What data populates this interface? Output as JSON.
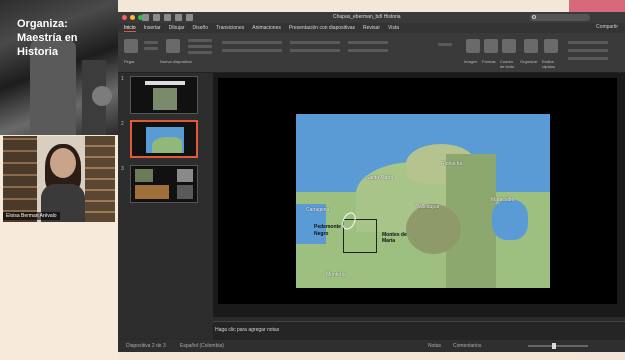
{
  "presentation": {
    "org_title_line1": "Organiza:",
    "org_title_line2": "Maestría en Historia",
    "presenter_name": "Eloisa Berman Arévalo"
  },
  "window": {
    "doc_title": "Chapas_eberman_bdl Historia"
  },
  "tabs": [
    {
      "label": "Inicio",
      "active": true
    },
    {
      "label": "Insertar"
    },
    {
      "label": "Dibujar"
    },
    {
      "label": "Diseño"
    },
    {
      "label": "Transiciones"
    },
    {
      "label": "Animaciones"
    },
    {
      "label": "Presentación con diapositivas"
    },
    {
      "label": "Revisar"
    },
    {
      "label": "Vista"
    }
  ],
  "share_label": "Compartir",
  "ribbon": {
    "paste": "Pegar",
    "new_slide": "Nueva diapositiva",
    "images": "Imagen",
    "shapes": "Formas",
    "textbox": "Cuadro de texto",
    "arrange": "Organizar",
    "quick_styles": "Estilos rápidos",
    "design_ideas": "Ideas de diseño"
  },
  "slides": [
    {
      "num": "1"
    },
    {
      "num": "2"
    },
    {
      "num": "3"
    }
  ],
  "map_labels": {
    "santa_marta": "Santa Marta",
    "cartagena": "Cartagena",
    "riohacha": "Riohacha",
    "maracaibo": "Maracaibo",
    "piedemonte": "Piedemonte Sagrado",
    "valledupar": "Valledupar",
    "montes": "Montes de María",
    "monteria": "Montería",
    "pedemonte_negro_1": "Pedemonte",
    "pedemonte_negro_2": "Negro"
  },
  "notes_placeholder": "Haga clic para agregar notas",
  "status": {
    "slide_count": "Diapositiva 2 de 3",
    "language": "Español (Colombia)",
    "notes_btn": "Notas",
    "comments_btn": "Comentarios"
  },
  "colors": {
    "accent": "#e0593a",
    "water": "#5b9bd5",
    "land_green": "#8fb87a"
  }
}
